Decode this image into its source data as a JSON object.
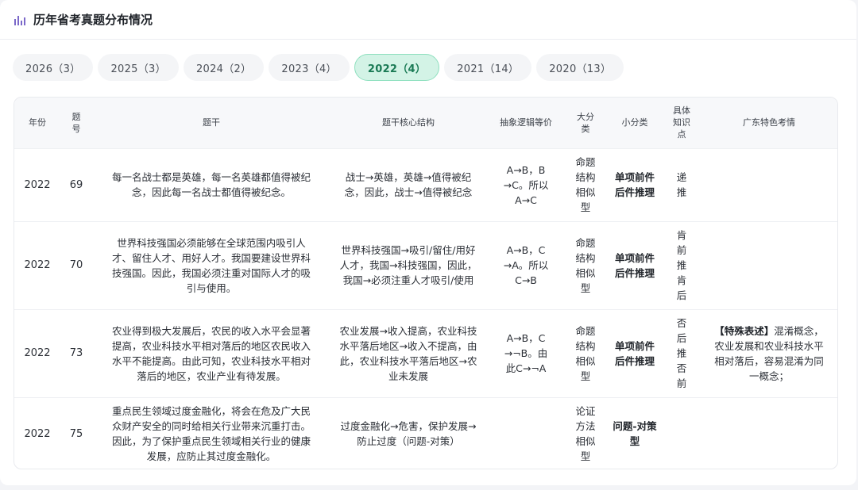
{
  "header": {
    "title": "历年省考真题分布情况",
    "icon": "bar-chart-icon"
  },
  "tabs": [
    {
      "label": "2026（3）",
      "active": false
    },
    {
      "label": "2025（3）",
      "active": false
    },
    {
      "label": "2024（2）",
      "active": false
    },
    {
      "label": "2023（4）",
      "active": false
    },
    {
      "label": "2022（4）",
      "active": true
    },
    {
      "label": "2021（14）",
      "active": false
    },
    {
      "label": "2020（13）",
      "active": false
    }
  ],
  "table": {
    "columns": {
      "year": "年份",
      "qnum": "题号",
      "stem": "题干",
      "core": "题干核心结构",
      "abstract": "抽象逻辑等价",
      "major": "大分类",
      "minor": "小分类",
      "knowledge": "具体知识点",
      "guangdong": "广东特色考情"
    },
    "rows": [
      {
        "year": "2022",
        "qnum": "69",
        "stem": "每一名战士都是英雄，每一名英雄都值得被纪念，因此每一名战士都值得被纪念。",
        "core": "战士→英雄，英雄→值得被纪念，因此，战士→值得被纪念",
        "abstract": "A→B，B→C。所以A→C",
        "major": "命题结构相似型",
        "minor": "单项前件后件推理",
        "knowledge": "递推",
        "gd_tag": "",
        "gd_text": ""
      },
      {
        "year": "2022",
        "qnum": "70",
        "stem": "世界科技强国必须能够在全球范围内吸引人才、留住人才、用好人才。我国要建设世界科技强国。因此，我国必须注重对国际人才的吸引与使用。",
        "core": "世界科技强国→吸引/留住/用好人才，我国→科技强国，因此，我国→必须注重人才吸引/使用",
        "abstract": "A→B，C→A。所以C→B",
        "major": "命题结构相似型",
        "minor": "单项前件后件推理",
        "knowledge": "肯前推肯后",
        "gd_tag": "",
        "gd_text": ""
      },
      {
        "year": "2022",
        "qnum": "73",
        "stem": "农业得到极大发展后，农民的收入水平会显著提高，农业科技水平相对落后的地区农民收入水平不能提高。由此可知，农业科技水平相对落后的地区，农业产业有待发展。",
        "core": "农业发展→收入提高，农业科技水平落后地区→收入不提高，由此，农业科技水平落后地区→农业未发展",
        "abstract": "A→B，C→¬B。由此C→¬A",
        "major": "命题结构相似型",
        "minor": "单项前件后件推理",
        "knowledge": "否后推否前",
        "gd_tag": "【特殊表述】",
        "gd_text": "混淆概念，农业发展和农业科技水平相对落后，容易混淆为同一概念；"
      },
      {
        "year": "2022",
        "qnum": "75",
        "stem": "重点民生领域过度金融化，将会在危及广大民众财产安全的同时给相关行业带来沉重打击。因此，为了保护重点民生领域相关行业的健康发展，应防止其过度金融化。",
        "core": "过度金融化→危害，保护发展→防止过度（问题-对策）",
        "abstract": "",
        "major": "论证方法相似型",
        "minor": "问题-对策型",
        "knowledge": "",
        "gd_tag": "",
        "gd_text": ""
      }
    ]
  }
}
